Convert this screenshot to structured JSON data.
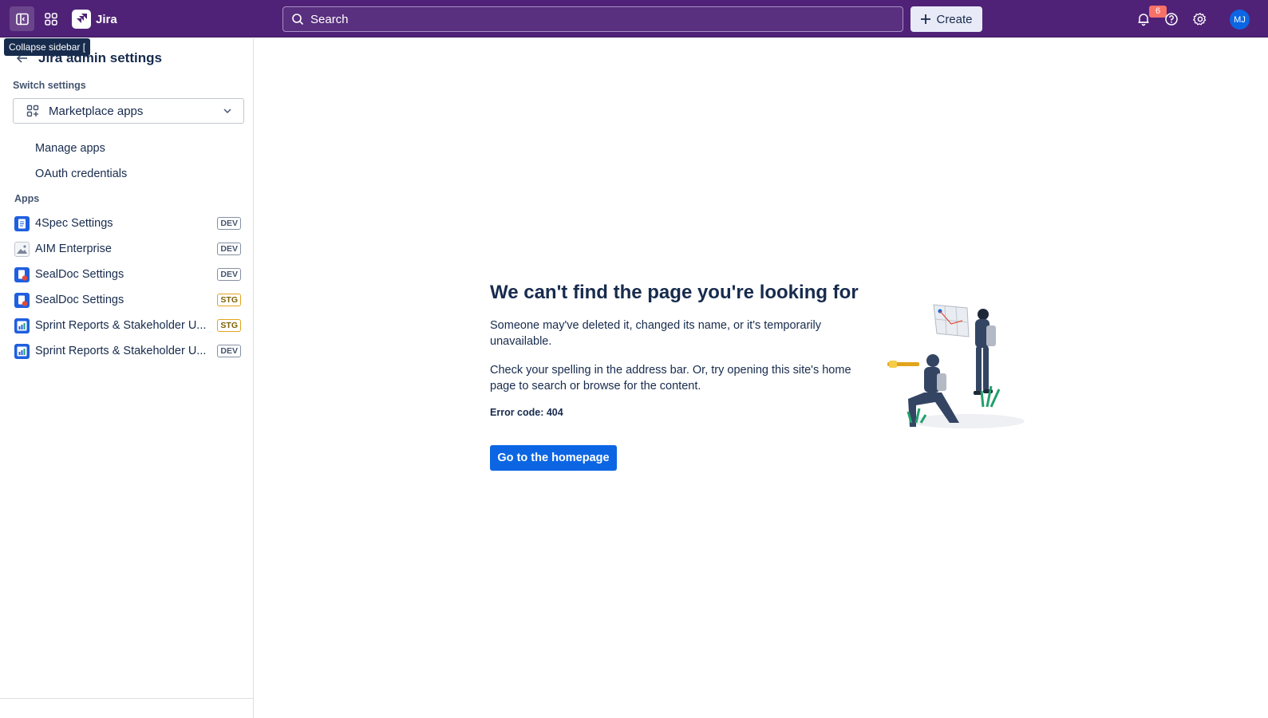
{
  "topbar": {
    "app_name": "Jira",
    "search_placeholder": "Search",
    "create_label": "Create",
    "notification_count": "6",
    "avatar_initials": "MJ"
  },
  "tooltip": "Collapse sidebar [",
  "sidebar": {
    "title": "Jira admin settings",
    "switch_label": "Switch settings",
    "switch_value": "Marketplace apps",
    "links": [
      "Manage apps",
      "OAuth credentials"
    ],
    "apps_label": "Apps",
    "apps": [
      {
        "name": "4Spec Settings",
        "tag": "DEV"
      },
      {
        "name": "AIM Enterprise",
        "tag": "DEV"
      },
      {
        "name": "SealDoc Settings",
        "tag": "DEV"
      },
      {
        "name": "SealDoc Settings",
        "tag": "STG"
      },
      {
        "name": "Sprint Reports & Stakeholder U...",
        "tag": "STG"
      },
      {
        "name": "Sprint Reports & Stakeholder U...",
        "tag": "DEV"
      }
    ]
  },
  "main": {
    "title": "We can't find the page you're looking for",
    "para1": "Someone may've deleted it, changed its name, or it's temporarily unavailable.",
    "para2": "Check your spelling in the address bar. Or, try opening this site's home page to search or browse for the content.",
    "error_code": "Error code: 404",
    "button_label": "Go to the homepage"
  },
  "colors": {
    "topbar": "#4f2277",
    "primary_button": "#0c66e4",
    "badge": "#f87168",
    "stg_tag": "#e2a41c"
  }
}
